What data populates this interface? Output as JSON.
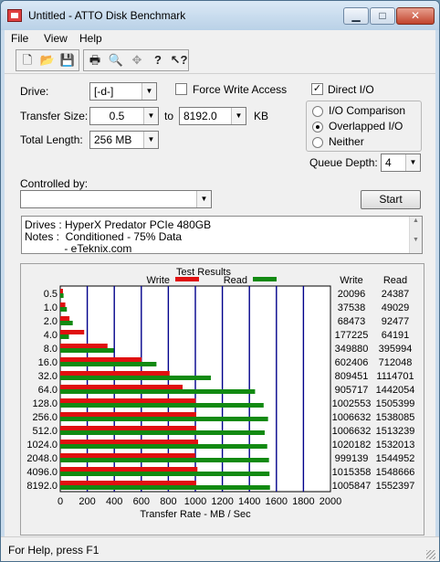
{
  "window": {
    "title": "Untitled - ATTO Disk Benchmark"
  },
  "menu": {
    "items": [
      "File",
      "View",
      "Help"
    ]
  },
  "toolbar": {
    "icons": [
      "new-icon",
      "open-icon",
      "save-icon",
      "print-icon",
      "print-preview-icon",
      "move-icon",
      "help-icon",
      "context-help-icon"
    ]
  },
  "settings": {
    "drive_label": "Drive:",
    "drive_value": "[-d-]",
    "force_write_label": "Force Write Access",
    "force_write_checked": false,
    "direct_io_label": "Direct I/O",
    "direct_io_checked": true,
    "transfer_size_label": "Transfer Size:",
    "transfer_from": "0.5",
    "to_label": "to",
    "transfer_to": "8192.0",
    "kb_label": "KB",
    "total_length_label": "Total Length:",
    "total_length_value": "256 MB",
    "io_options": [
      "I/O Comparison",
      "Overlapped I/O",
      "Neither"
    ],
    "io_selected": "Overlapped I/O",
    "queue_depth_label": "Queue Depth:",
    "queue_depth_value": "4",
    "controlled_by_label": "Controlled by:",
    "controlled_by_value": "",
    "start_label": "Start"
  },
  "notes": {
    "lines": [
      "Drives : HyperX Predator PCIe 480GB",
      "Notes :  Conditioned - 75% Data",
      "             - eTeknix.com"
    ]
  },
  "status": {
    "text": "For Help, press F1"
  },
  "colors": {
    "write": "#e01010",
    "read": "#128a12",
    "gridline": "#00008b"
  },
  "chart_data": {
    "type": "bar",
    "title": "Test Results",
    "orientation": "horizontal",
    "categories": [
      "0.5",
      "1.0",
      "2.0",
      "4.0",
      "8.0",
      "16.0",
      "32.0",
      "64.0",
      "128.0",
      "256.0",
      "512.0",
      "1024.0",
      "2048.0",
      "4096.0",
      "8192.0"
    ],
    "series": [
      {
        "name": "Write",
        "values": [
          20096,
          37538,
          68473,
          177225,
          349880,
          602406,
          809451,
          905717,
          1002553,
          1006632,
          1006632,
          1020182,
          999139,
          1015358,
          1005847
        ]
      },
      {
        "name": "Read",
        "values": [
          24387,
          49029,
          92477,
          64191,
          395994,
          712048,
          1114701,
          1442054,
          1505399,
          1538085,
          1513239,
          1532013,
          1544952,
          1548666,
          1552397
        ]
      }
    ],
    "xlabel": "Transfer Rate - MB / Sec",
    "xlim": [
      0,
      2000
    ],
    "xticks": [
      "0",
      "200",
      "400",
      "600",
      "800",
      "1000",
      "1200",
      "1400",
      "1600",
      "1800",
      "2000"
    ],
    "column_headers": [
      "Write",
      "Read"
    ],
    "legend": [
      "Write",
      "Read"
    ],
    "legend_position": "top",
    "grid": true
  }
}
